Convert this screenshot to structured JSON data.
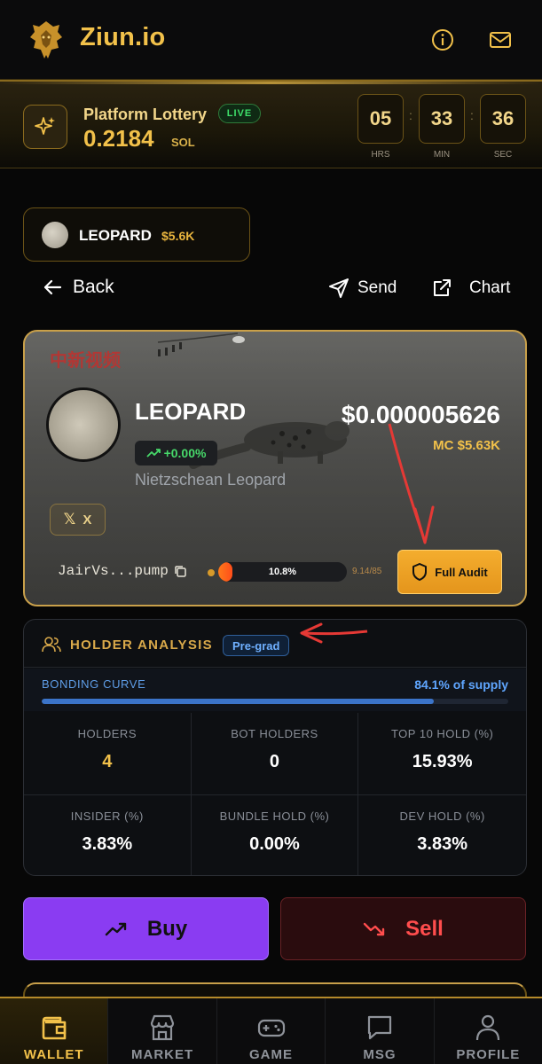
{
  "app": {
    "brand": "Ziun.io",
    "accent": "#f2c14a"
  },
  "lottery": {
    "title": "Platform Lottery",
    "live_label": "LIVE",
    "amount": "0.2184",
    "unit": "SOL",
    "countdown": [
      {
        "value": "05",
        "label": "HRS"
      },
      {
        "value": "33",
        "label": "MIN"
      },
      {
        "value": "36",
        "label": "SEC"
      }
    ]
  },
  "token_chip": {
    "name": "LEOPARD",
    "market_cap": "$5.6K"
  },
  "nav": {
    "back": "Back",
    "send": "Send",
    "chart": "Chart"
  },
  "token": {
    "watermark": "中新视频",
    "name": "LEOPARD",
    "change": "+0.00%",
    "subtitle": "Nietzschean Leopard",
    "price": "$0.000005626",
    "mc": "MC $5.63K",
    "social_x": "X",
    "address": "JairVs...pump",
    "progress_label": "10.8%",
    "progress_fraction": 0.108,
    "progress_count": "9.14/85",
    "audit_label": "Full Audit"
  },
  "holder_analysis": {
    "title": "HOLDER ANALYSIS",
    "badge": "Pre-grad",
    "bonding_label": "BONDING CURVE",
    "bonding_value": "84.1% of supply",
    "bonding_fraction": 0.841,
    "stats": [
      {
        "label": "HOLDERS",
        "value": "4"
      },
      {
        "label": "BOT HOLDERS",
        "value": "0"
      },
      {
        "label": "TOP 10 HOLD (%)",
        "value": "15.93%"
      },
      {
        "label": "INSIDER (%)",
        "value": "3.83%"
      },
      {
        "label": "BUNDLE HOLD (%)",
        "value": "0.00%"
      },
      {
        "label": "DEV HOLD (%)",
        "value": "3.83%"
      }
    ]
  },
  "actions": {
    "buy": "Buy",
    "sell": "Sell"
  },
  "tabs": [
    {
      "label": "WALLET",
      "icon": "wallet-icon",
      "active": true
    },
    {
      "label": "MARKET",
      "icon": "store-icon",
      "active": false
    },
    {
      "label": "GAME",
      "icon": "gamepad-icon",
      "active": false
    },
    {
      "label": "MSG",
      "icon": "message-icon",
      "active": false
    },
    {
      "label": "PROFILE",
      "icon": "user-icon",
      "active": false
    }
  ]
}
